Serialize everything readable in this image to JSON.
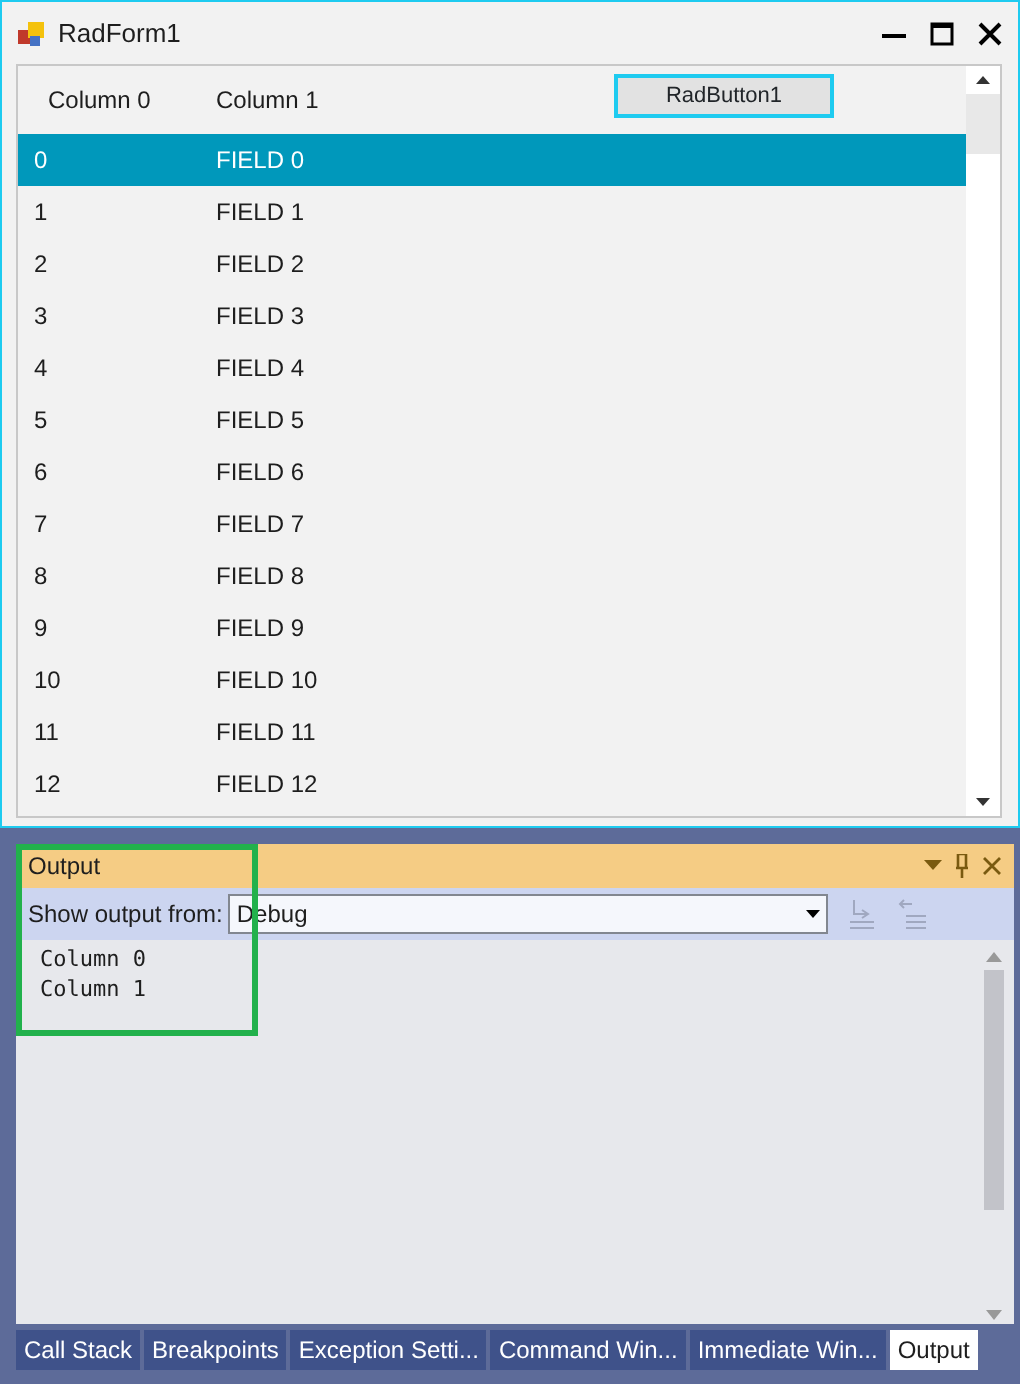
{
  "window": {
    "title": "RadForm1"
  },
  "grid": {
    "columns": [
      "Column 0",
      "Column 1"
    ],
    "button": "RadButton1",
    "rows": [
      {
        "cells": [
          "0",
          "FIELD 0"
        ],
        "selected": true
      },
      {
        "cells": [
          "1",
          "FIELD 1"
        ],
        "selected": false
      },
      {
        "cells": [
          "2",
          "FIELD 2"
        ],
        "selected": false
      },
      {
        "cells": [
          "3",
          "FIELD 3"
        ],
        "selected": false
      },
      {
        "cells": [
          "4",
          "FIELD 4"
        ],
        "selected": false
      },
      {
        "cells": [
          "5",
          "FIELD 5"
        ],
        "selected": false
      },
      {
        "cells": [
          "6",
          "FIELD 6"
        ],
        "selected": false
      },
      {
        "cells": [
          "7",
          "FIELD 7"
        ],
        "selected": false
      },
      {
        "cells": [
          "8",
          "FIELD 8"
        ],
        "selected": false
      },
      {
        "cells": [
          "9",
          "FIELD 9"
        ],
        "selected": false
      },
      {
        "cells": [
          "10",
          "FIELD 10"
        ],
        "selected": false
      },
      {
        "cells": [
          "11",
          "FIELD 11"
        ],
        "selected": false
      },
      {
        "cells": [
          "12",
          "FIELD 12"
        ],
        "selected": false
      }
    ]
  },
  "output": {
    "title": "Output",
    "source_label": "Show output from:",
    "source": "Debug",
    "lines": [
      "Column 0",
      "Column 1"
    ]
  },
  "tabs": [
    {
      "label": "Call Stack",
      "selected": false
    },
    {
      "label": "Breakpoints",
      "selected": false
    },
    {
      "label": "Exception Setti...",
      "selected": false
    },
    {
      "label": "Command Win...",
      "selected": false
    },
    {
      "label": "Immediate Win...",
      "selected": false
    },
    {
      "label": "Output",
      "selected": true
    }
  ]
}
